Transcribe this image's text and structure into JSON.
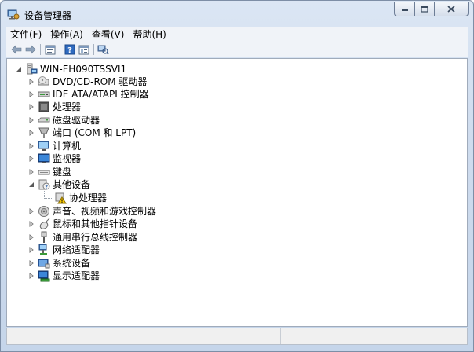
{
  "window": {
    "title": "设备管理器"
  },
  "menu": [
    {
      "label": "文件(F)"
    },
    {
      "label": "操作(A)"
    },
    {
      "label": "查看(V)"
    },
    {
      "label": "帮助(H)"
    }
  ],
  "toolbar": [
    {
      "icon": "back-arrow-icon"
    },
    {
      "icon": "forward-arrow-icon"
    },
    {
      "icon": "properties-icon"
    },
    {
      "icon": "help-icon"
    },
    {
      "icon": "view-details-icon"
    },
    {
      "icon": "scan-hardware-icon"
    }
  ],
  "tree": {
    "root": {
      "label": "WIN-EH090TSSVI1",
      "icon": "computer-root-icon",
      "expanded": true
    },
    "items": [
      {
        "label": "DVD/CD-ROM 驱动器",
        "icon": "dvd-drive-icon",
        "expanded": false
      },
      {
        "label": "IDE ATA/ATAPI 控制器",
        "icon": "ide-controller-icon",
        "expanded": false
      },
      {
        "label": "处理器",
        "icon": "processor-icon",
        "expanded": false
      },
      {
        "label": "磁盘驱动器",
        "icon": "disk-drive-icon",
        "expanded": false
      },
      {
        "label": "端口 (COM 和 LPT)",
        "icon": "port-icon",
        "expanded": false
      },
      {
        "label": "计算机",
        "icon": "computer-icon",
        "expanded": false
      },
      {
        "label": "监视器",
        "icon": "monitor-icon",
        "expanded": false
      },
      {
        "label": "键盘",
        "icon": "keyboard-icon",
        "expanded": false
      },
      {
        "label": "其他设备",
        "icon": "other-devices-icon",
        "expanded": true,
        "children": [
          {
            "label": "协处理器",
            "icon": "warning-device-icon"
          }
        ]
      },
      {
        "label": "声音、视频和游戏控制器",
        "icon": "sound-icon",
        "expanded": false
      },
      {
        "label": "鼠标和其他指针设备",
        "icon": "mouse-icon",
        "expanded": false
      },
      {
        "label": "通用串行总线控制器",
        "icon": "usb-icon",
        "expanded": false
      },
      {
        "label": "网络适配器",
        "icon": "network-adapter-icon",
        "expanded": false
      },
      {
        "label": "系统设备",
        "icon": "system-devices-icon",
        "expanded": false
      },
      {
        "label": "显示适配器",
        "icon": "display-adapter-icon",
        "expanded": false
      }
    ]
  },
  "colors": {
    "frame": "#c5d5ea",
    "content_bg": "#ffffff",
    "guide": "#9aa3ad"
  }
}
